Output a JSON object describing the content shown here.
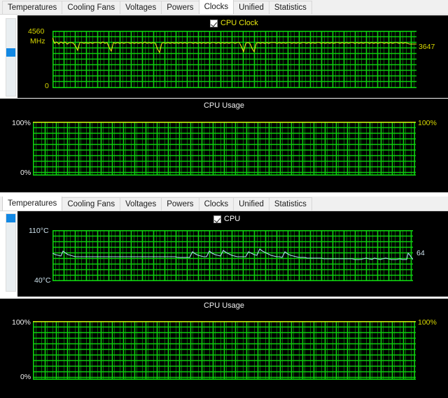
{
  "window_top": {
    "tabs": [
      {
        "label": "Temperatures",
        "active": false
      },
      {
        "label": "Cooling Fans",
        "active": false
      },
      {
        "label": "Voltages",
        "active": false
      },
      {
        "label": "Powers",
        "active": false
      },
      {
        "label": "Clocks",
        "active": true
      },
      {
        "label": "Unified",
        "active": false
      },
      {
        "label": "Statistics",
        "active": false
      }
    ],
    "graph_main": {
      "title": "",
      "legend_label": "CPU Clock",
      "legend_checked": true,
      "y_max_label": "4560",
      "y_unit_label": "MHz",
      "y_min_label": "0",
      "current_value_label": "3647"
    },
    "graph_usage": {
      "title": "CPU Usage",
      "y_max_label": "100%",
      "y_min_label": "0%",
      "current_value_label": "100%"
    }
  },
  "window_bottom": {
    "tabs": [
      {
        "label": "Temperatures",
        "active": true
      },
      {
        "label": "Cooling Fans",
        "active": false
      },
      {
        "label": "Voltages",
        "active": false
      },
      {
        "label": "Powers",
        "active": false
      },
      {
        "label": "Clocks",
        "active": false
      },
      {
        "label": "Unified",
        "active": false
      },
      {
        "label": "Statistics",
        "active": false
      }
    ],
    "graph_main": {
      "title": "",
      "legend_label": "CPU",
      "legend_checked": true,
      "y_max_label": "110°C",
      "y_min_label": "40°C",
      "current_value_label": "64"
    },
    "graph_usage": {
      "title": "CPU Usage",
      "y_max_label": "100%",
      "y_min_label": "0%",
      "current_value_label": "100%"
    }
  },
  "colors": {
    "grid_major": "#0ecf0e",
    "grid_minor": "#0a6b0a",
    "plot_bg": "#000000",
    "clock_line": "#e8e80f",
    "temp_line": "#a8d8ee",
    "usage_line": "#e8e80f",
    "accent_scrollbar": "#1288e4"
  },
  "chart_data": [
    {
      "type": "line",
      "name": "cpu-clock",
      "title": "CPU Clock",
      "ylabel": "MHz",
      "ylim": [
        0,
        4560
      ],
      "yticks": [
        0,
        4560
      ],
      "ytick_labels": [
        "0",
        "4560"
      ],
      "current_value": 3647,
      "series": [
        {
          "name": "CPU Clock",
          "color": "#e8e80f",
          "values": [
            3980,
            3780,
            3820,
            3760,
            3840,
            3790,
            3830,
            3770,
            3810,
            3800,
            3790,
            3560,
            3180,
            3790,
            3800,
            3780,
            3810,
            3790,
            3800,
            3780,
            3810,
            3795,
            3805,
            3780,
            3815,
            3790,
            3800,
            3470,
            3170,
            3800,
            3790,
            3810,
            3780,
            3800,
            3790,
            3810,
            3800,
            3780,
            3805,
            3790,
            3810,
            3790,
            3800,
            3785,
            3815,
            3790,
            3805,
            3780,
            3800,
            3790,
            3280,
            3010,
            3780,
            3800,
            3790,
            3810,
            3780,
            3800,
            3790,
            3805,
            3780,
            3800,
            3790,
            3810,
            3780,
            3795,
            3810,
            3780,
            3800,
            3790,
            3805,
            3780,
            3800,
            3790,
            3810,
            3780,
            3800,
            3795,
            3780,
            3810,
            3790,
            3800,
            3780,
            3805,
            3790,
            3800,
            3810,
            3780,
            3795,
            3805,
            3540,
            3120,
            3790,
            3800,
            3780,
            3420,
            3120,
            3790,
            3805,
            3780,
            3800,
            3790,
            3810,
            3780,
            3800,
            3795,
            3785,
            3805,
            3780,
            3800,
            3790,
            3810,
            3780,
            3800,
            3790,
            3805,
            3780,
            3800,
            3790,
            3810,
            3780,
            3800,
            3790,
            3805,
            3780,
            3800,
            3790,
            3810,
            3780,
            3800,
            3790,
            3805,
            3780,
            3800,
            3790,
            3810,
            3780,
            3795,
            3790,
            3805,
            3780,
            3800,
            3790,
            3810,
            3780,
            3800,
            3790,
            3805,
            3780,
            3800,
            3790,
            3810,
            3780,
            3800,
            3790,
            3805,
            3780,
            3800,
            3790,
            3647
          ]
        }
      ]
    },
    {
      "type": "line",
      "name": "cpu-usage-top",
      "title": "CPU Usage",
      "ylim": [
        0,
        100
      ],
      "yticks": [
        0,
        100
      ],
      "ytick_labels": [
        "0%",
        "100%"
      ],
      "current_value": 100,
      "series": [
        {
          "name": "CPU Usage",
          "color": "#e8e80f",
          "constant_value": 100
        }
      ]
    },
    {
      "type": "line",
      "name": "cpu-temperature",
      "title": "CPU",
      "ylim": [
        40,
        110
      ],
      "yticks": [
        40,
        110
      ],
      "ytick_labels": [
        "40°C",
        "110°C"
      ],
      "current_value": 64,
      "series": [
        {
          "name": "CPU",
          "color": "#a8d8ee",
          "values": [
            73,
            71,
            70,
            69,
            76,
            73,
            71,
            70,
            69,
            68,
            68,
            68,
            68,
            68,
            68,
            68,
            68,
            68,
            68,
            68,
            68,
            68,
            68,
            68,
            68,
            68,
            68,
            68,
            68,
            68,
            68,
            68,
            68,
            68,
            68,
            68,
            68,
            68,
            68,
            68,
            68,
            68,
            68,
            68,
            68,
            68,
            68,
            68,
            68,
            68,
            68,
            68,
            68,
            67,
            67,
            67,
            67,
            67,
            74,
            72,
            70,
            69,
            68,
            68,
            75,
            73,
            71,
            70,
            69,
            76,
            74,
            72,
            70,
            69,
            68,
            68,
            68,
            68,
            75,
            73,
            71,
            70,
            77,
            75,
            73,
            71,
            70,
            69,
            68,
            68,
            67,
            74,
            72,
            70,
            69,
            68,
            67,
            67,
            67,
            66,
            66,
            66,
            66,
            66,
            66,
            66,
            65,
            65,
            65,
            65,
            65,
            65,
            65,
            65,
            65,
            65,
            65,
            65,
            65,
            65,
            64,
            64,
            64,
            65,
            66,
            65,
            64,
            66,
            65,
            64,
            65,
            66,
            65,
            64,
            64,
            64,
            65,
            64,
            64,
            64,
            64,
            64,
            64,
            64,
            64,
            64,
            64,
            64,
            64,
            64,
            64,
            64,
            64,
            64,
            72,
            70,
            68,
            66,
            65,
            64
          ]
        }
      ]
    },
    {
      "type": "line",
      "name": "cpu-usage-bottom",
      "title": "CPU Usage",
      "ylim": [
        0,
        100
      ],
      "yticks": [
        0,
        100
      ],
      "ytick_labels": [
        "0%",
        "100%"
      ],
      "current_value": 100,
      "series": [
        {
          "name": "CPU Usage",
          "color": "#e8e80f",
          "constant_value": 100
        }
      ]
    }
  ]
}
